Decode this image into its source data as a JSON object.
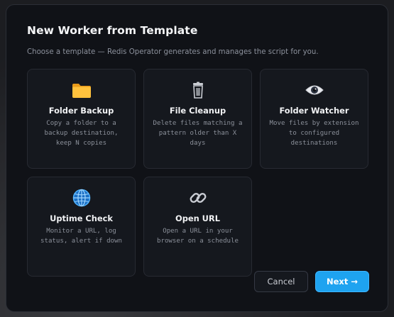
{
  "dialog": {
    "title": "New Worker from Template",
    "subtitle": "Choose a template — Redis Operator generates and manages the script for you."
  },
  "templates": [
    {
      "name": "Folder Backup",
      "icon": "folder-icon",
      "description": "Copy a folder to a backup destination, keep N copies"
    },
    {
      "name": "File Cleanup",
      "icon": "trash-icon",
      "description": "Delete files matching a pattern older than X days"
    },
    {
      "name": "Folder Watcher",
      "icon": "eye-icon",
      "description": "Move files by extension to configured destinations"
    },
    {
      "name": "Uptime Check",
      "icon": "globe-icon",
      "description": "Monitor a URL, log status, alert if down"
    },
    {
      "name": "Open URL",
      "icon": "link-icon",
      "description": "Open a URL in your browser on a schedule"
    }
  ],
  "buttons": {
    "cancel": "Cancel",
    "next": "Next →"
  },
  "colors": {
    "accent": "#1ea3f0",
    "dialog_bg": "#101217",
    "card_bg": "#15181e"
  }
}
